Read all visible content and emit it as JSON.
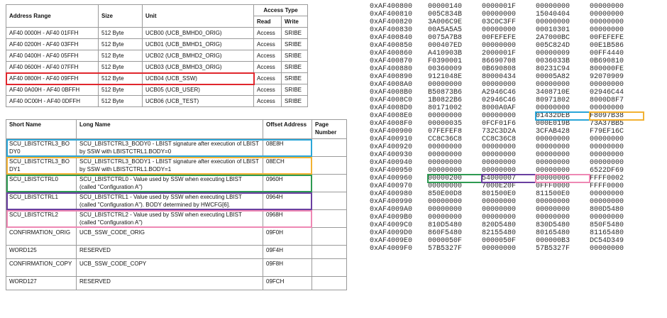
{
  "addr_table": {
    "headers": [
      "Address Range",
      "Size",
      "Unit",
      "Access Type"
    ],
    "sub_headers": [
      "Read",
      "Write"
    ],
    "rows": [
      [
        "AF40 0000H  -  AF40 01FFH",
        "512 Byte",
        "UCB00 (UCB_BMHD0_ORIG)",
        "Access",
        "SRIBE"
      ],
      [
        "AF40 0200H  -  AF40 03FFH",
        "512 Byte",
        "UCB01 (UCB_BMHD1_ORIG)",
        "Access",
        "SRIBE"
      ],
      [
        "AF40 0400H  -  AF40 05FFH",
        "512 Byte",
        "UCB02 (UCB_BMHD2_ORIG)",
        "Access",
        "SRIBE"
      ],
      [
        "AF40 0600H  -  AF40 07FFH",
        "512 Byte",
        "UCB03 (UCB_BMHD3_ORIG)",
        "Access",
        "SRIBE"
      ],
      [
        "AF40 0800H  -  AF40 09FFH",
        "512 Byte",
        "UCB04 (UCB_SSW)",
        "Access",
        "SRIBE"
      ],
      [
        "AF40 0A00H  -  AF40 0BFFH",
        "512 Byte",
        "UCB05 (UCB_USER)",
        "Access",
        "SRIBE"
      ],
      [
        "AF40 0C00H  -  AF40 0DFFH",
        "512 Byte",
        "UCB06 (UCB_TEST)",
        "Access",
        "SRIBE"
      ]
    ]
  },
  "reg_table": {
    "headers": [
      "Short Name",
      "Long Name",
      "Offset Address",
      "Page Number"
    ],
    "rows": [
      [
        "SCU_LBISTCTRL3_BODY0",
        "SCU_LBISTCTRL3_BODY0 - LBIST signature after execution of LBIST by SSW with LBISTCTRL1.BODY=0",
        "08E8H",
        ""
      ],
      [
        "SCU_LBISTCTRL3_BODY1",
        "SCU_LBISTCTRL3_BODY1 - LBIST signature after execution of LBIST by SSW with LBISTCTRL1.BODY=1",
        "08ECH",
        ""
      ],
      [
        "SCU_LBISTCTRL0",
        "SCU_LBISTCTRL0 - Value used by SSW when executing LBIST (called \"Configuration A\")",
        "0960H",
        ""
      ],
      [
        "SCU_LBISTCTRL1",
        "SCU_LBISTCTRL1 - Value used by SSW when executing LBIST (called \"Configuration A\"). BODY determined by HWCFG[6].",
        "0964H",
        ""
      ],
      [
        "SCU_LBISTCTRL2",
        "SCU_LBISTCTRL2 - Value used by SSW when executing LBIST (called \"Configuration A\")",
        "0968H",
        ""
      ],
      [
        "CONFIRMATION_ORIG",
        "UCB_SSW_CODE_ORIG",
        "09F0H",
        ""
      ],
      [
        "WORD125",
        "RESERVED",
        "09F4H",
        ""
      ],
      [
        "CONFIRMATION_COPY",
        "UCB_SSW_CODE_COPY",
        "09F8H",
        ""
      ],
      [
        "WORD127",
        "RESERVED",
        "09FCH",
        ""
      ]
    ]
  },
  "hex_dump": [
    [
      "0xAF400800",
      "00000140",
      "0000001F",
      "00000000",
      "00000000"
    ],
    [
      "0xAF400810",
      "005C834B",
      "00000000",
      "15040404",
      "00000000"
    ],
    [
      "0xAF400820",
      "3A006C9E",
      "03C0C3FF",
      "00000000",
      "00000000"
    ],
    [
      "0xAF400830",
      "00A5A5A5",
      "00000000",
      "00010301",
      "00000000"
    ],
    [
      "0xAF400840",
      "0075A7B8",
      "00FEFEFE",
      "2A7000BC",
      "00FEFEFE"
    ],
    [
      "0xAF400850",
      "000407ED",
      "00000000",
      "005C824D",
      "00E1B586"
    ],
    [
      "0xAF400860",
      "A410903B",
      "2000001F",
      "00000009",
      "00FF4440"
    ],
    [
      "0xAF400870",
      "F0390001",
      "86690708",
      "0036033B",
      "0B690810"
    ],
    [
      "0xAF400880",
      "00360009",
      "0B690808",
      "80231C94",
      "800000FE"
    ],
    [
      "0xAF400890",
      "9121048E",
      "80000434",
      "00005A82",
      "92070909"
    ],
    [
      "0xAF4008A0",
      "00000000",
      "00000000",
      "00000000",
      "00000000"
    ],
    [
      "0xAF4008B0",
      "B50873B6",
      "A2946C46",
      "3408710E",
      "02946C44"
    ],
    [
      "0xAF4008C0",
      "1B0822B6",
      "02946C46",
      "80971802",
      "8000D8F7"
    ],
    [
      "0xAF4008D0",
      "80171002",
      "8000A0AF",
      "00000000",
      "00000000"
    ],
    [
      "0xAF4008E0",
      "00000000",
      "00000000",
      "01432DEB",
      "F8097B38"
    ],
    [
      "0xAF4008F0",
      "00000035",
      "0FCF01F6",
      "000E019B",
      "73A37BB5"
    ],
    [
      "0xAF400900",
      "07FEFEF8",
      "732C3D2A",
      "3CFAB428",
      "F79EF16C"
    ],
    [
      "0xAF400910",
      "CC8C36C8",
      "CC8C36C8",
      "00000000",
      "00000000"
    ],
    [
      "0xAF400920",
      "00000000",
      "00000000",
      "00000000",
      "00000000"
    ],
    [
      "0xAF400930",
      "00000000",
      "00000000",
      "00000000",
      "00000000"
    ],
    [
      "0xAF400940",
      "00000000",
      "00000000",
      "00000000",
      "00000000"
    ],
    [
      "0xAF400950",
      "00000000",
      "00000000",
      "00000000",
      "6522DF69"
    ],
    [
      "0xAF400960",
      "00000200",
      "54000007",
      "00000006",
      "FFFF0002"
    ],
    [
      "0xAF400970",
      "00000000",
      "7000E20F",
      "0FFF0000",
      "FFFF0000"
    ],
    [
      "0xAF400980",
      "850E00D8",
      "801500E0",
      "811500E0",
      "00000000"
    ],
    [
      "0xAF400990",
      "00000000",
      "00000000",
      "00000000",
      "00000000"
    ],
    [
      "0xAF4009A0",
      "00000000",
      "00000000",
      "00000000",
      "800D5480"
    ],
    [
      "0xAF4009B0",
      "00000000",
      "00000000",
      "00000000",
      "00000000"
    ],
    [
      "0xAF4009C0",
      "810D5480",
      "820D5480",
      "830D5480",
      "850F5480"
    ],
    [
      "0xAF4009D0",
      "860F5480",
      "82155480",
      "80165480",
      "81165480"
    ],
    [
      "0xAF4009E0",
      "0000050F",
      "0000050F",
      "000000B3",
      "DC54D349"
    ],
    [
      "0xAF4009F0",
      "57B5327F",
      "00000000",
      "57B5327F",
      "00000000"
    ]
  ],
  "highlight_colors": {
    "red": "#e0272d",
    "blue": "#2aa6d8",
    "orange": "#f2b233",
    "green": "#2e9a52",
    "purple": "#6a3fa0",
    "pink": "#ee88b4"
  }
}
